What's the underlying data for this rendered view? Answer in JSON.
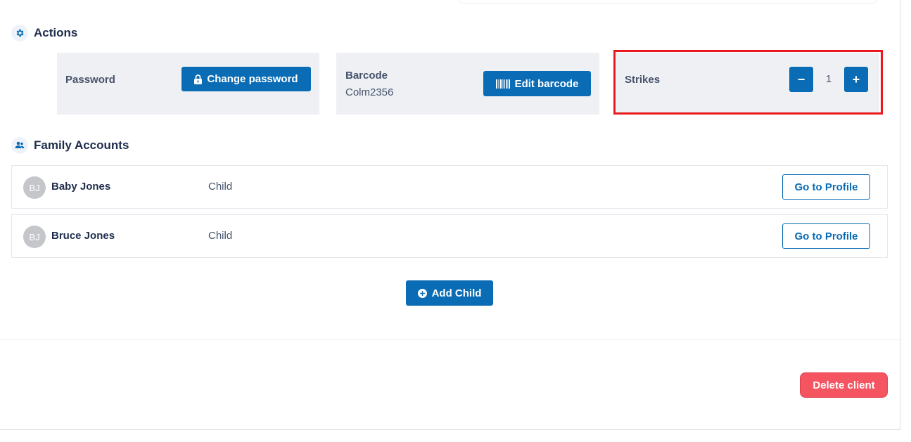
{
  "actions": {
    "title": "Actions",
    "password": {
      "label": "Password",
      "button_label": "Change password"
    },
    "barcode": {
      "label": "Barcode",
      "value": "Colm2356",
      "button_label": "Edit barcode"
    },
    "strikes": {
      "label": "Strikes",
      "value": "1",
      "decrement_label": "−",
      "increment_label": "+"
    }
  },
  "family": {
    "title": "Family Accounts",
    "members": [
      {
        "initials": "BJ",
        "name": "Baby Jones",
        "role": "Child",
        "button_label": "Go to Profile"
      },
      {
        "initials": "BJ",
        "name": "Bruce Jones",
        "role": "Child",
        "button_label": "Go to Profile"
      }
    ],
    "add_child_label": "Add Child"
  },
  "delete_label": "Delete client",
  "icons": {
    "actions": "gear-icon",
    "family": "users-icon",
    "password": "lock-icon",
    "barcode": "barcode-icon",
    "add_child": "plus-circle-icon"
  },
  "colors": {
    "primary": "#0a6cb4",
    "danger": "#f55461",
    "highlight": "#e8191f",
    "card_bg": "#eef0f4"
  }
}
